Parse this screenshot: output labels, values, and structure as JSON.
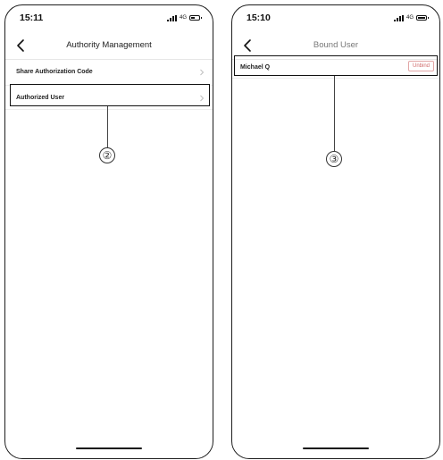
{
  "left_screen": {
    "status": {
      "time": "15:11",
      "network": "4G"
    },
    "nav": {
      "title": "Authority Management"
    },
    "rows": [
      {
        "label": "Share Authorization Code"
      },
      {
        "label": "Authorized User"
      }
    ],
    "callout": "②"
  },
  "right_screen": {
    "status": {
      "time": "15:10",
      "network": "4G"
    },
    "nav": {
      "title": "Bound User"
    },
    "user_row": {
      "name": "Michael Q",
      "button": "Unbind"
    },
    "callout": "③"
  }
}
